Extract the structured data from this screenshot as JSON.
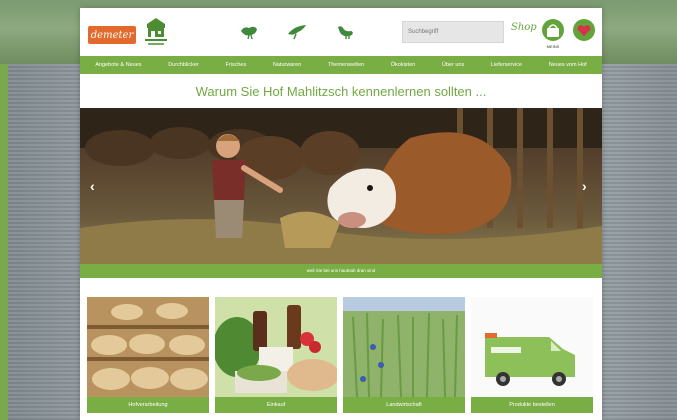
{
  "header": {
    "logo_text": "demeter",
    "search_placeholder": "Suchbegriff",
    "shop_label": "Shop",
    "cart_label": "MEINS",
    "animal_icons": [
      "hen-icon",
      "bird-icon",
      "goose-icon"
    ]
  },
  "nav": {
    "items": [
      "Angebote & Neues",
      "Durchblicker",
      "Frisches",
      "Naturwaren",
      "Themenwelten",
      "Ökokisten",
      "Über uns",
      "Lieferservice",
      "Neues vom Hof"
    ]
  },
  "main": {
    "headline": "Warum Sie Hof Mahlitzsch kennenlernen sollten ...",
    "slider_caption": "weil Sie bei uns hautnah dran sind",
    "prev_arrow": "‹",
    "next_arrow": "›"
  },
  "tiles": [
    {
      "label": "Hofverarbeitung"
    },
    {
      "label": "Einkauf"
    },
    {
      "label": "Landwirtschaft"
    },
    {
      "label": "Produkte bestellen"
    }
  ],
  "colors": {
    "brand_green": "#79ae45",
    "demeter_orange": "#e26a2c",
    "heart_red": "#d6334a"
  }
}
